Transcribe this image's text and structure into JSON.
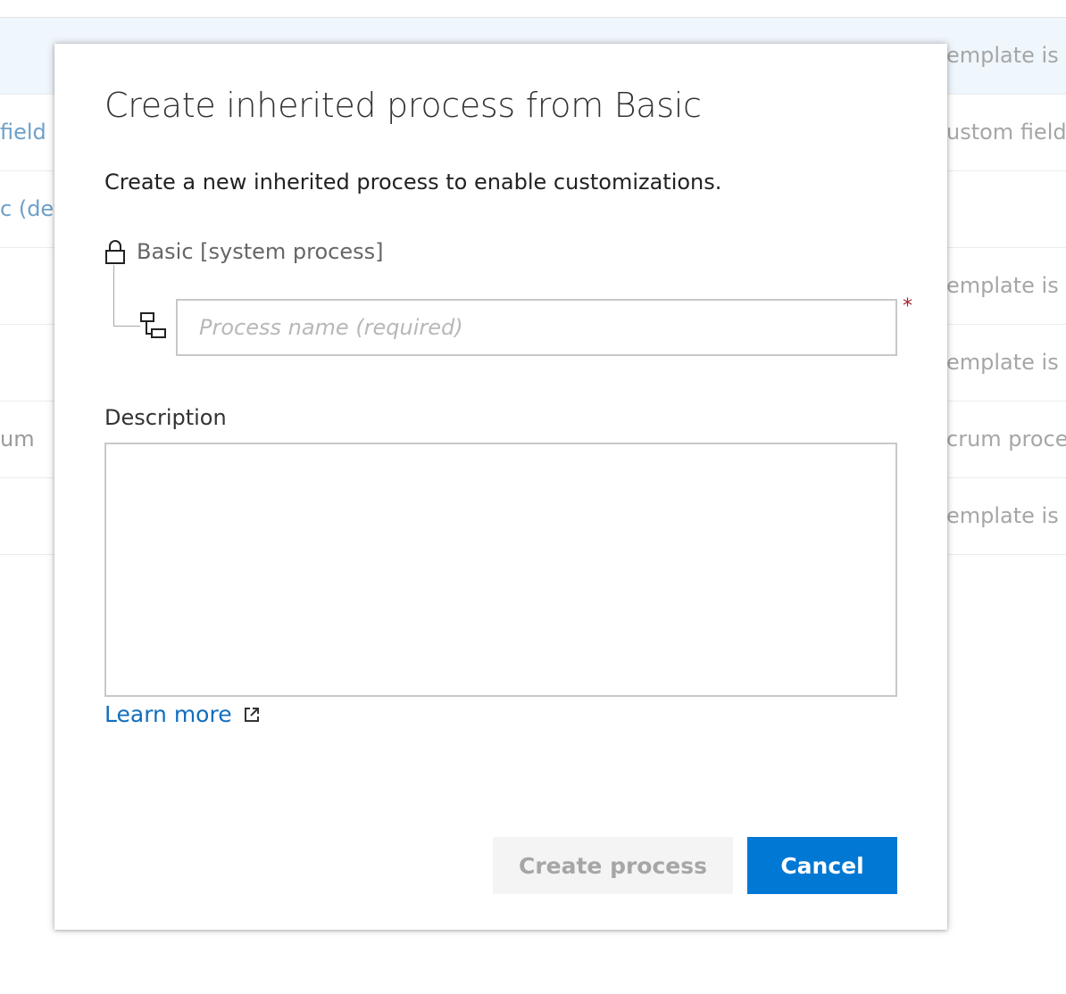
{
  "background": {
    "rows": [
      {
        "left": "",
        "right": "emplate is t",
        "selected": true
      },
      {
        "left": "field",
        "right": "ustom field",
        "left_link": true
      },
      {
        "left": "c (def",
        "right": "",
        "left_link": true
      },
      {
        "left": "",
        "right": "emplate is t"
      },
      {
        "left": "",
        "right": "emplate is t"
      },
      {
        "left": "um",
        "right": "crum proce"
      },
      {
        "left": "",
        "right": "emplate is t"
      }
    ]
  },
  "dialog": {
    "title": "Create inherited process from Basic",
    "subtitle": "Create a new inherited process to enable customizations.",
    "parent_process": "Basic [system process]",
    "name_input": {
      "placeholder": "Process name (required)",
      "value": "",
      "required_marker": "*"
    },
    "description": {
      "label": "Description",
      "value": ""
    },
    "learn_more": "Learn more",
    "buttons": {
      "create": "Create process",
      "cancel": "Cancel"
    }
  },
  "colors": {
    "primary": "#0078d4",
    "link": "#106ebe",
    "required": "#a4262c",
    "disabled_bg": "#f4f4f4",
    "disabled_text": "#a6a6a6"
  },
  "icons": {
    "parent": "lock-icon",
    "child": "inherited-process-icon",
    "learn_more": "external-link-icon"
  }
}
